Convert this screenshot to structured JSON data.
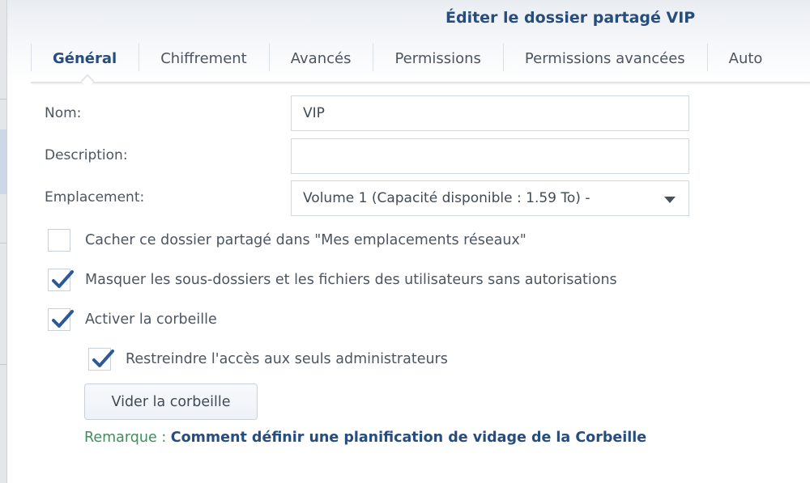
{
  "window": {
    "title": "Éditer le dossier partagé VIP"
  },
  "tabs": [
    {
      "label": "Général",
      "active": true
    },
    {
      "label": "Chiffrement",
      "active": false
    },
    {
      "label": "Avancés",
      "active": false
    },
    {
      "label": "Permissions",
      "active": false
    },
    {
      "label": "Permissions avancées",
      "active": false
    },
    {
      "label": "Auto",
      "active": false
    }
  ],
  "form": {
    "name_label": "Nom:",
    "name_value": "VIP",
    "description_label": "Description:",
    "description_value": "",
    "location_label": "Emplacement:",
    "location_value": "Volume 1 (Capacité disponible :  1.59 To) -"
  },
  "checkboxes": [
    {
      "label": "Cacher ce dossier partagé dans \"Mes emplacements réseaux\"",
      "checked": false
    },
    {
      "label": "Masquer les sous-dossiers et les fichiers des utilisateurs sans autorisations",
      "checked": true
    },
    {
      "label": "Activer la corbeille",
      "checked": true
    },
    {
      "label": "Restreindre l'accès aux seuls administrateurs",
      "checked": true
    }
  ],
  "buttons": {
    "empty_recycle_bin": "Vider la corbeille"
  },
  "note": {
    "label": "Remarque : ",
    "link": "Comment définir une planification de vidage de la Corbeille"
  },
  "colors": {
    "accent": "#264d7e",
    "note_label": "#3e8f5c",
    "checkmark": "#2c5a95"
  }
}
